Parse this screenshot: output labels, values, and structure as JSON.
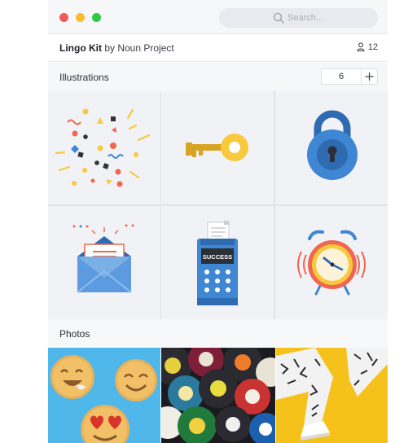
{
  "search": {
    "placeholder": "Search..."
  },
  "kit": {
    "name": "Lingo Kit",
    "by_text": "by Noun Project",
    "member_count": "12"
  },
  "sections": {
    "illustrations": {
      "label": "Illustrations",
      "columns_value": "6"
    },
    "photos": {
      "label": "Photos"
    }
  },
  "illustrations": [
    {
      "icon": "confetti-icon"
    },
    {
      "icon": "key-icon"
    },
    {
      "icon": "padlock-icon"
    },
    {
      "icon": "envelope-icon"
    },
    {
      "icon": "payment-terminal-icon",
      "text": "SUCCESS"
    },
    {
      "icon": "alarm-clock-icon"
    }
  ],
  "photos": [
    {
      "subject": "emoji-cookies-photo"
    },
    {
      "subject": "vinyl-records-photo"
    },
    {
      "subject": "patterned-pants-photo"
    }
  ],
  "colors": {
    "close": "#f25a58",
    "minimize": "#f6bd2f",
    "zoom": "#2ccb3f",
    "accent_blue": "#3f86d3",
    "accent_yellow": "#f8c93c",
    "accent_red": "#ef6750"
  }
}
